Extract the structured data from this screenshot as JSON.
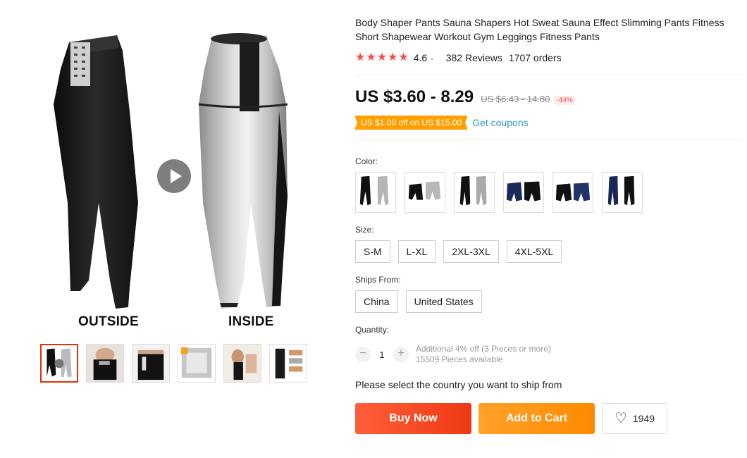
{
  "product": {
    "title": "Body Shaper Pants Sauna Shapers Hot Sweat Sauna Effect Slimming Pants Fitness Short Shapewear Workout Gym Leggings Fitness Pants",
    "rating": "4.6",
    "reviews": "382 Reviews",
    "orders": "1707 orders",
    "stars_filled": 5
  },
  "gallery": {
    "caption_outside": "OUTSIDE",
    "caption_inside": "INSIDE",
    "thumbnails": [
      "thumb-1",
      "thumb-2",
      "thumb-3",
      "thumb-4",
      "thumb-5",
      "thumb-6"
    ],
    "active_thumbnail": 0
  },
  "price": {
    "current": "US $3.60 - 8.29",
    "original": "US $6.43 - 14.80",
    "discount": "-44%"
  },
  "coupon": {
    "tag": "US $1.00 off on US $15.00",
    "link": "Get coupons"
  },
  "color": {
    "label": "Color:",
    "swatches": [
      "black-silver long",
      "black-silver short",
      "black-silver capri",
      "navy-black short",
      "black-navy short",
      "navy long"
    ]
  },
  "size": {
    "label": "Size:",
    "options": [
      "S-M",
      "L-XL",
      "2XL-3XL",
      "4XL-5XL"
    ]
  },
  "ships_from": {
    "label": "Ships From:",
    "options": [
      "China",
      "United States"
    ]
  },
  "quantity": {
    "label": "Quantity:",
    "minus": "−",
    "value": "1",
    "plus": "+",
    "note_discount": "Additional 4% off (3 Pieces or more)",
    "note_stock": "15509 Pieces available"
  },
  "ship_note": "Please select the country you want to ship from",
  "actions": {
    "buy_now": "Buy Now",
    "add_to_cart": "Add to Cart",
    "wishlist_count": "1949"
  },
  "colors": {
    "accent_red": "#ff4747",
    "buy_gradient_start": "#ff5e3a",
    "cart_orange": "#ff9f00",
    "coupon_orange": "#ff9f00",
    "link_blue": "#2e9cc3"
  },
  "icons": {
    "star": "star-icon",
    "play": "play-icon",
    "heart": "heart-icon",
    "chevron": "chevron-down-icon"
  }
}
